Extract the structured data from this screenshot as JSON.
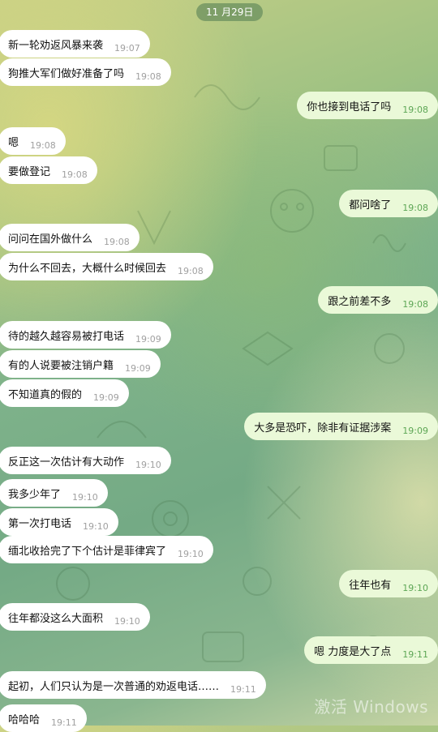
{
  "date": "11 月29日",
  "messages": [
    {
      "side": "in",
      "text": "新一轮劝返风暴来袭",
      "time": "19:07"
    },
    {
      "side": "in",
      "text": "狗推大军们做好准备了吗",
      "time": "19:08"
    },
    {
      "side": "out",
      "text": "你也接到电话了吗",
      "time": "19:08"
    },
    {
      "side": "in",
      "text": "嗯",
      "time": "19:08"
    },
    {
      "side": "in",
      "text": "要做登记",
      "time": "19:08"
    },
    {
      "side": "out",
      "text": "都问啥了",
      "time": "19:08"
    },
    {
      "side": "in",
      "text": "问问在国外做什么",
      "time": "19:08"
    },
    {
      "side": "in",
      "text": "为什么不回去，大概什么时候回去",
      "time": "19:08"
    },
    {
      "side": "out",
      "text": "跟之前差不多",
      "time": "19:08"
    },
    {
      "side": "in",
      "text": "待的越久越容易被打电话",
      "time": "19:09"
    },
    {
      "side": "in",
      "text": "有的人说要被注销户籍",
      "time": "19:09"
    },
    {
      "side": "in",
      "text": "不知道真的假的",
      "time": "19:09"
    },
    {
      "side": "out",
      "text": "大多是恐吓，除非有证据涉案",
      "time": "19:09"
    },
    {
      "side": "in",
      "text": "反正这一次估计有大动作",
      "time": "19:10"
    },
    {
      "side": "in",
      "text": "我多少年了",
      "time": "19:10"
    },
    {
      "side": "in",
      "text": "第一次打电话",
      "time": "19:10"
    },
    {
      "side": "in",
      "text": "缅北收拾完了下个估计是菲律宾了",
      "time": "19:10"
    },
    {
      "side": "out",
      "text": "往年也有",
      "time": "19:10"
    },
    {
      "side": "in",
      "text": "往年都没这么大面积",
      "time": "19:10"
    },
    {
      "side": "out",
      "text": "嗯 力度是大了点",
      "time": "19:11"
    },
    {
      "side": "in",
      "text": "起初，人们只认为是一次普通的劝返电话……",
      "time": "19:11"
    },
    {
      "side": "in",
      "text": "哈哈哈",
      "time": "19:11"
    }
  ],
  "watermark": "激活 Windows"
}
